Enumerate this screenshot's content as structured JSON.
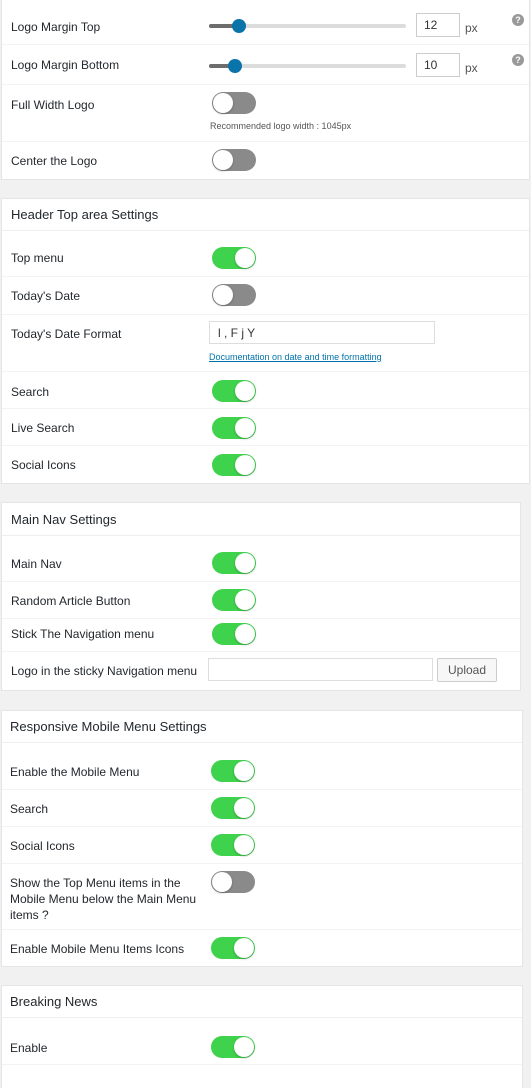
{
  "logo_section": {
    "rows": {
      "margin_top": {
        "label": "Logo Margin Top",
        "value": "12",
        "unit": "px",
        "slider_fraction": 0.15
      },
      "margin_bottom": {
        "label": "Logo Margin Bottom",
        "value": "10",
        "unit": "px",
        "slider_fraction": 0.13
      },
      "full_width": {
        "label": "Full Width Logo",
        "state": "off",
        "note": "Recommended logo width : 1045px"
      },
      "center": {
        "label": "Center the Logo",
        "state": "off"
      }
    },
    "help_glyph": "?"
  },
  "header_top": {
    "title": "Header Top area Settings",
    "rows": {
      "top_menu": {
        "label": "Top menu",
        "state": "on"
      },
      "todays_date": {
        "label": "Today's Date",
        "state": "off"
      },
      "date_format": {
        "label": "Today's Date Format",
        "value": "l , F j Y",
        "link": "Documentation on date and time formatting"
      },
      "search": {
        "label": "Search",
        "state": "on"
      },
      "live_search": {
        "label": "Live Search",
        "state": "on"
      },
      "social_icons": {
        "label": "Social Icons",
        "state": "on"
      }
    }
  },
  "main_nav": {
    "title": "Main Nav Settings",
    "rows": {
      "main_nav": {
        "label": "Main Nav",
        "state": "on"
      },
      "random_article": {
        "label": "Random Article Button",
        "state": "on"
      },
      "stick_nav": {
        "label": "Stick The Navigation menu",
        "state": "on"
      },
      "sticky_logo": {
        "label": "Logo in the sticky Navigation menu",
        "value": "",
        "button": "Upload"
      }
    }
  },
  "mobile_menu": {
    "title": "Responsive Mobile Menu Settings",
    "rows": {
      "enable": {
        "label": "Enable the Mobile Menu",
        "state": "on"
      },
      "search": {
        "label": "Search",
        "state": "on"
      },
      "social_icons": {
        "label": "Social Icons",
        "state": "on"
      },
      "top_menu_items": {
        "label": "Show the Top Menu items in the Mobile Menu below the Main Menu items ?",
        "state": "off"
      },
      "item_icons": {
        "label": "Enable Mobile Menu Items Icons",
        "state": "on"
      }
    }
  },
  "breaking_news": {
    "title": "Breaking News",
    "rows": {
      "enable": {
        "label": "Enable",
        "state": "on"
      }
    }
  },
  "colors": {
    "toggle_on": "#3fd24c",
    "toggle_off": "#8a8a8a",
    "slider_thumb": "#0a73aa",
    "link": "#0073aa"
  }
}
